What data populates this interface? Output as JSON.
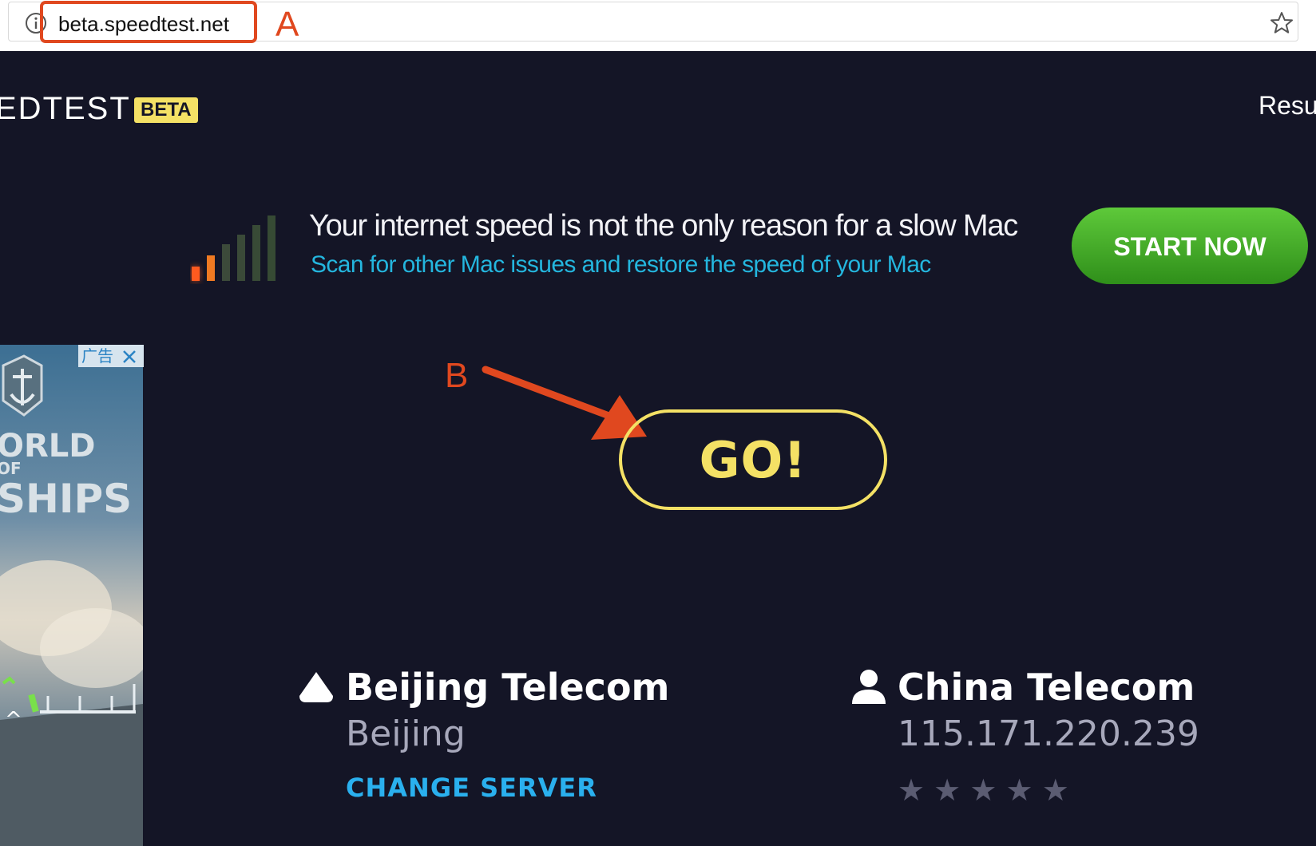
{
  "browser": {
    "url": "beta.speedtest.net",
    "info_icon": "info-icon",
    "bookmark_icon": "star-icon"
  },
  "annotations": {
    "a_label": "A",
    "b_label": "B",
    "color": "#e0481f"
  },
  "header": {
    "logo_text": "EDTEST",
    "beta_badge": "BETA",
    "nav_results": "Resu"
  },
  "promo": {
    "headline": "Your internet speed is not the only reason for a slow Mac",
    "subtext": "Scan for other Mac issues and restore the speed of your Mac",
    "button_label": "START NOW",
    "icon": "signal-bars-icon"
  },
  "ad": {
    "tag": "广告",
    "close_icon": "close-icon",
    "brand_lines": [
      "ORLD",
      "OF",
      "SHIPS"
    ]
  },
  "go_button": {
    "label": "GO!"
  },
  "server": {
    "icon": "server-icon",
    "name": "Beijing Telecom",
    "location": "Beijing",
    "change_label": "CHANGE SERVER"
  },
  "isp": {
    "icon": "user-icon",
    "name": "China Telecom",
    "ip": "115.171.220.239",
    "rating_stars": [
      "★",
      "★",
      "★",
      "★",
      "★"
    ]
  },
  "colors": {
    "background": "#141526",
    "accent_yellow": "#f4e165",
    "link_blue": "#2ab0ee",
    "promo_green": "#3fae24"
  }
}
